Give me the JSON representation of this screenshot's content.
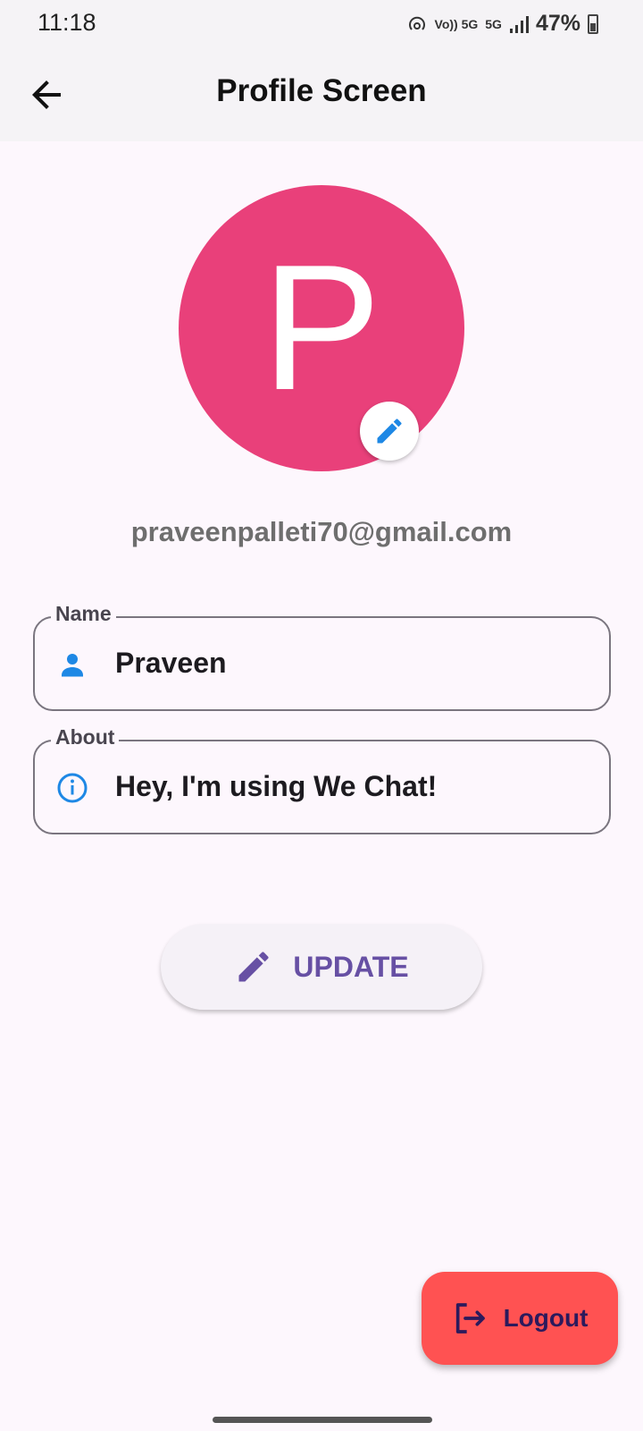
{
  "status_bar": {
    "time": "11:18",
    "network_labels": [
      "Vo)) 5G",
      "5G"
    ],
    "battery": "47%"
  },
  "app_bar": {
    "title": "Profile Screen"
  },
  "profile": {
    "avatar_letter": "P",
    "avatar_color": "#E9407A",
    "email": "praveenpalleti70@gmail.com"
  },
  "form": {
    "name": {
      "label": "Name",
      "value": "Praveen"
    },
    "about": {
      "label": "About",
      "value": "Hey, I'm using We Chat!"
    }
  },
  "update_button": {
    "label": "UPDATE"
  },
  "logout_button": {
    "label": "Logout"
  },
  "colors": {
    "accent_blue": "#1E88E5",
    "accent_purple": "#6750A4",
    "logout_red": "#FF5252",
    "background": "#FDF7FD"
  }
}
